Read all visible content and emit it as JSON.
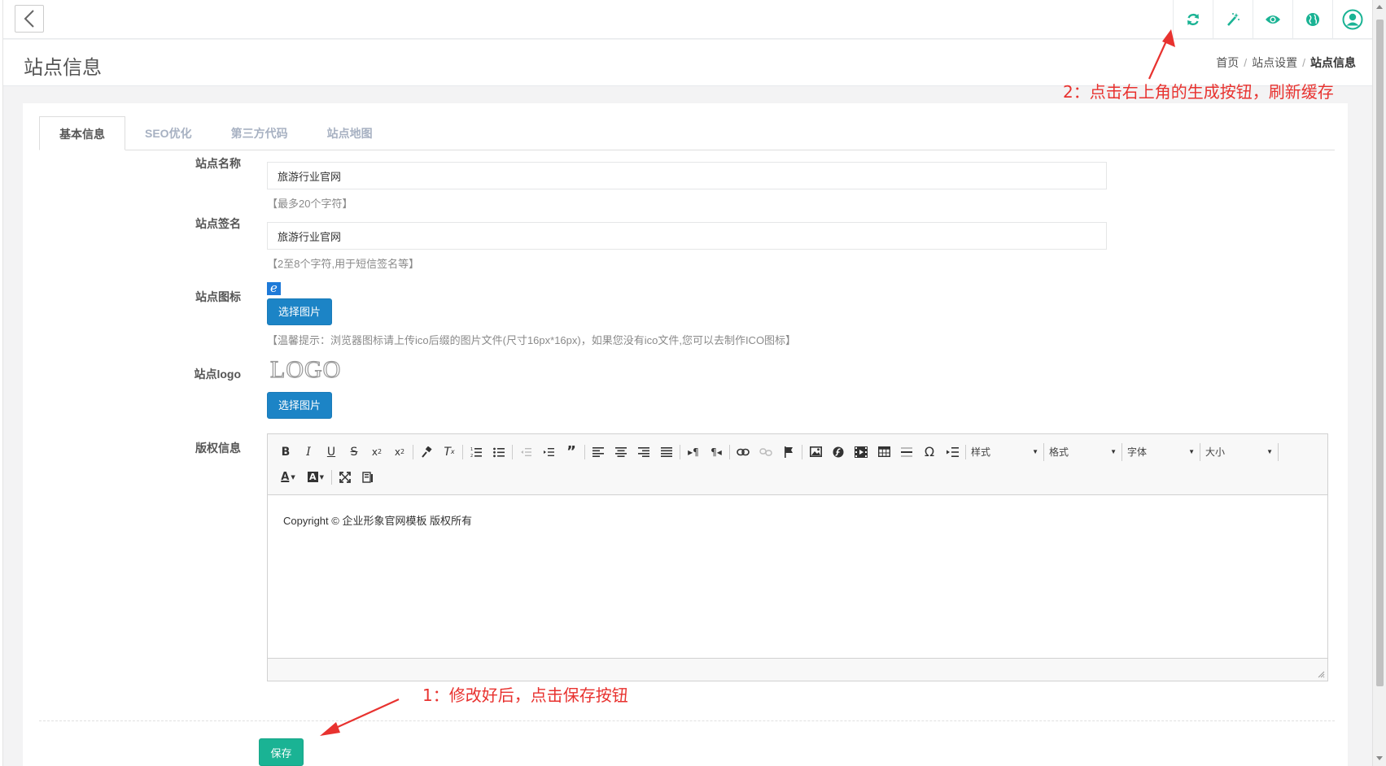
{
  "header": {
    "back_icon": "chevron-left-icon",
    "icons": [
      {
        "name": "refresh-icon",
        "color": "#1ab394"
      },
      {
        "name": "magic-wand-icon",
        "color": "#1ab394"
      },
      {
        "name": "eye-icon",
        "color": "#1ab394"
      },
      {
        "name": "globe-icon",
        "color": "#1ab394"
      },
      {
        "name": "user-circle-icon",
        "color": "#1ab394"
      }
    ]
  },
  "page": {
    "title": "站点信息",
    "breadcrumb": [
      "首页",
      "站点设置",
      "站点信息"
    ]
  },
  "annotations": {
    "note_refresh": "2：点击右上角的生成按钮，刷新缓存",
    "note_save": "1：修改好后，点击保存按钮"
  },
  "tabs": [
    {
      "label": "基本信息",
      "active": true
    },
    {
      "label": "SEO优化",
      "active": false
    },
    {
      "label": "第三方代码",
      "active": false
    },
    {
      "label": "站点地图",
      "active": false
    }
  ],
  "form": {
    "site_name": {
      "label": "站点名称",
      "value": "旅游行业官网",
      "hint": "【最多20个字符】"
    },
    "site_signature": {
      "label": "站点签名",
      "value": "旅游行业官网",
      "hint": "【2至8个字符,用于短信签名等】"
    },
    "site_icon": {
      "label": "站点图标",
      "button": "选择图片",
      "thumb_glyph": "e",
      "hint": "【温馨提示：浏览器图标请上传ico后缀的图片文件(尺寸16px*16px)，如果您没有ico文件,您可以去制作ICO图标】"
    },
    "site_logo": {
      "label": "站点logo",
      "button": "选择图片",
      "logo_text": "LOGO"
    },
    "copyright": {
      "label": "版权信息",
      "content": "Copyright ©  企业形象官网模板  版权所有",
      "toolbar_combos": [
        "样式",
        "格式",
        "字体",
        "大小"
      ]
    }
  },
  "actions": {
    "save_label": "保存"
  },
  "colors": {
    "primary": "#1c84c6",
    "success": "#1ab394",
    "annotation": "#e8322f"
  }
}
